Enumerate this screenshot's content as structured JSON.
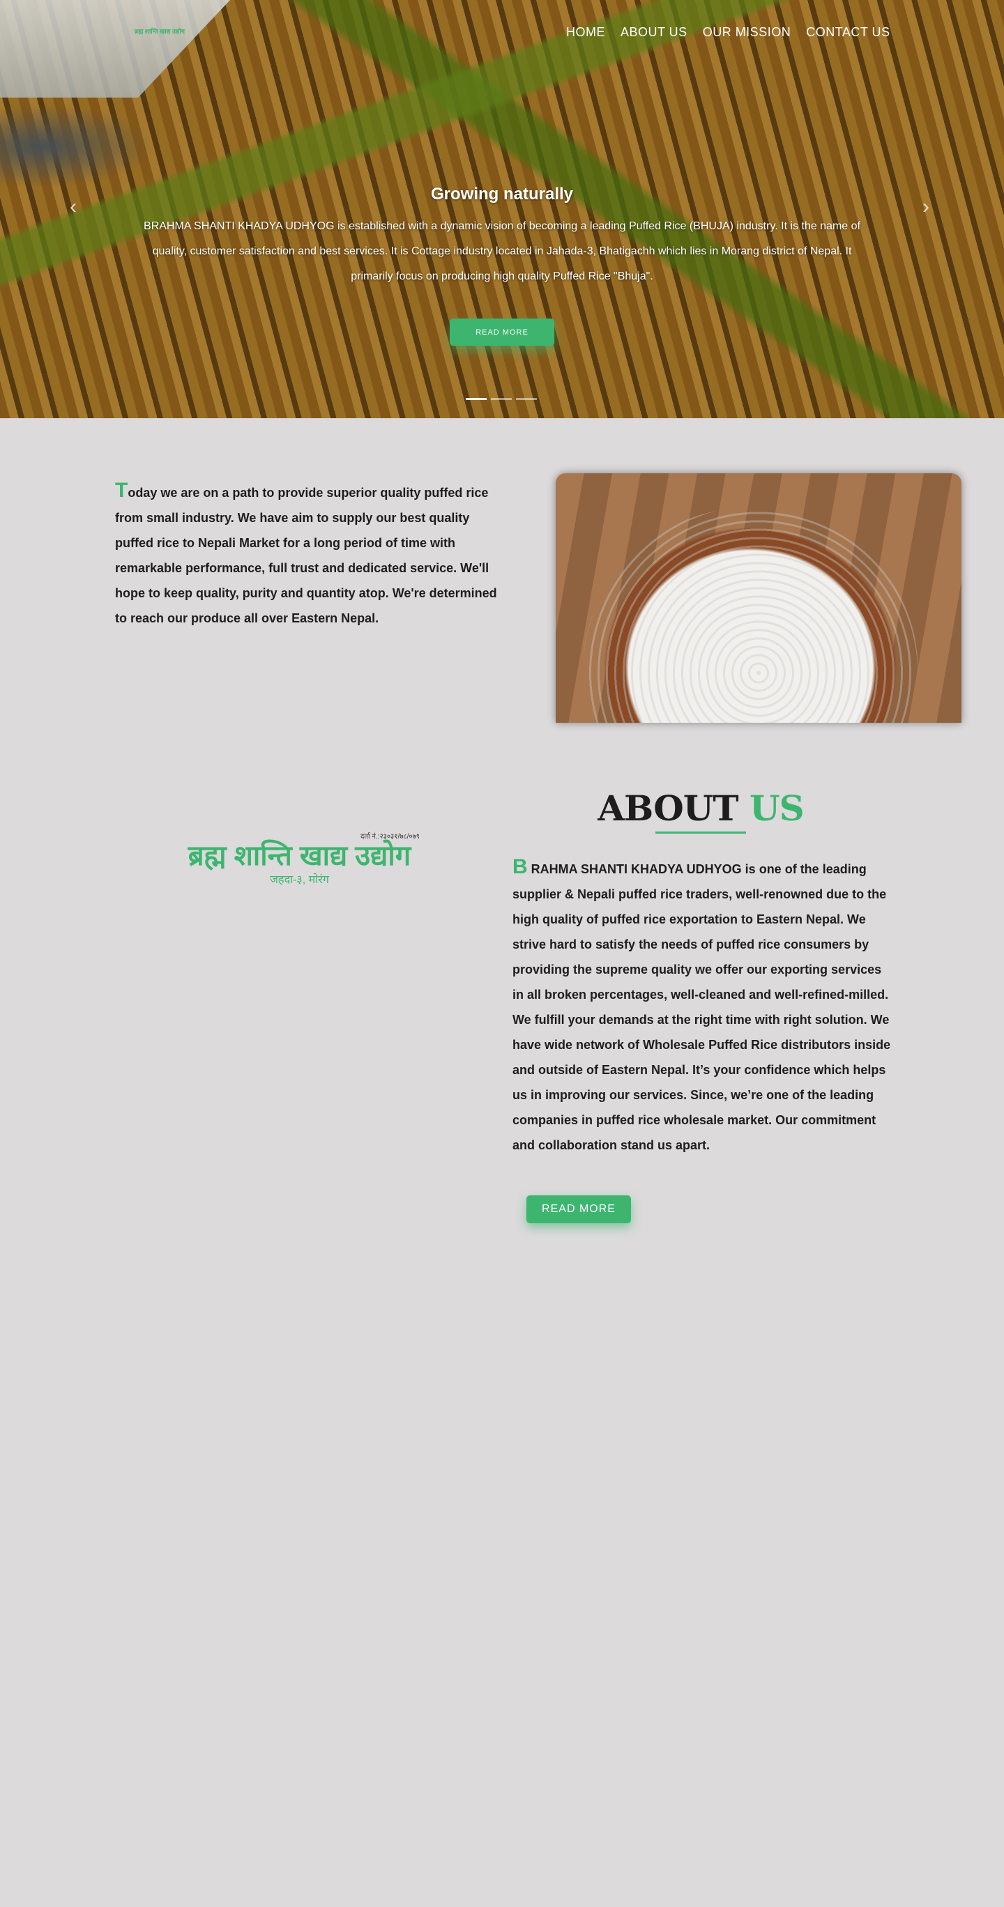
{
  "header": {
    "logo_text": "ब्रह्म शान्ति खाद्य उद्योग",
    "nav": [
      "HOME",
      "ABOUT US",
      "OUR MISSION",
      "CONTACT US"
    ]
  },
  "hero": {
    "title": "Growing naturally",
    "text": "BRAHMA SHANTI KHADYA UDHYOG is established with a dynamic vision of becoming a leading Puffed Rice (BHUJA) industry. It is the name of quality, customer satisfaction and best services. It is Cottage industry located in Jahada-3, Bhatigachh which lies in Morang district of Nepal. It primarily focus on producing high quality Puffed Rice \"Bhuja\".",
    "button": "READ MORE",
    "prev": "‹",
    "next": "›",
    "slides": 3,
    "active_slide": 1
  },
  "intro": {
    "first_letter": "T",
    "text": "oday we are on a path to provide superior quality puffed rice from small industry. We have aim to supply our best quality puffed rice to Nepali Market for a long period of time with remarkable performance, full trust and dedicated service. We'll hope to keep quality, purity and quantity atop. We're determined to reach our produce all over Eastern Nepal."
  },
  "logo": {
    "reg": "दर्ता नं.:२३०३१/७८/०७९",
    "name": "ब्रह्म शान्ति खाद्य उद्योग",
    "address": "जहदा-३, मोरंग"
  },
  "about": {
    "heading_dark": "ABOUT",
    "heading_green": "US",
    "first_letter": "B",
    "text": " RAHMA SHANTI KHADYA UDHYOG is one of the leading supplier & Nepali puffed rice traders, well-renowned due to the high quality of puffed rice exportation to Eastern Nepal. We strive hard to satisfy the needs of puffed rice consumers by providing the supreme quality we offer our exporting services in all broken percentages, well-cleaned and well-refined-milled. We fulfill your demands at the right time with right solution. We have wide network of Wholesale Puffed Rice distributors inside and outside of Eastern Nepal. It’s your confidence which helps us in improving our services. Since, we’re one of the leading companies in puffed rice wholesale market. Our commitment and collaboration stand us apart.",
    "button": "READ MORE"
  },
  "colors": {
    "accent": "#3db56f",
    "background": "#dcdadb"
  }
}
